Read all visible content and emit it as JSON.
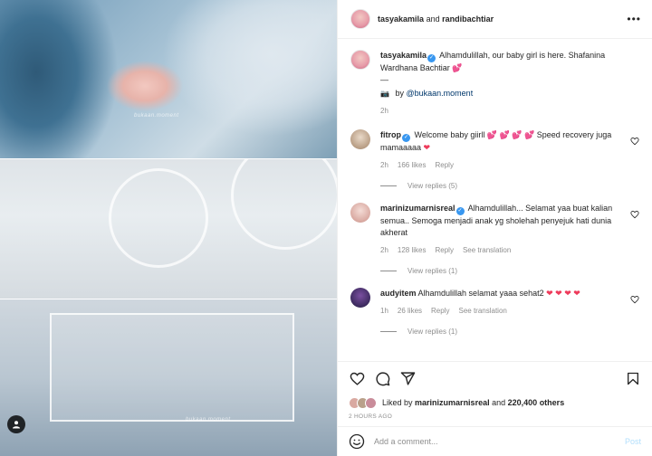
{
  "post": {
    "header": {
      "username": "tasyakamila",
      "and_text": "and",
      "collaborator": "randibachtiar",
      "more_label": "•••"
    },
    "caption": {
      "username": "tasyakamila",
      "text": "Alhamdulillah, our baby girl is here. Shafanina Wardhana Bachtiar",
      "emoji": "💕",
      "separator": "—",
      "credit_prefix": "by",
      "credit_handle": "@bukaan.moment",
      "time": "2h"
    },
    "comments": [
      {
        "username": "fitrop",
        "text": "Welcome baby giirll",
        "emoji": "💕 💕 💕 💕",
        "text2": "Speed recovery juga mamaaaaa",
        "emoji2": "❤",
        "time": "2h",
        "likes": "166 likes",
        "reply": "Reply",
        "translate": "",
        "view_replies": "View replies (5)"
      },
      {
        "username": "marinizumarnisreal",
        "text": "Alhamdulillah... Selamat yaa buat kalian semua.. Semoga menjadi anak yg sholehah penyejuk hati dunia akherat",
        "emoji": "",
        "text2": "",
        "emoji2": "",
        "time": "2h",
        "likes": "128 likes",
        "reply": "Reply",
        "translate": "See translation",
        "view_replies": "View replies (1)"
      },
      {
        "username": "audyitem",
        "text": "Alhamdulillah selamat yaaa sehat2",
        "emoji": "❤ ❤ ❤ ❤",
        "text2": "",
        "emoji2": "",
        "time": "1h",
        "likes": "26 likes",
        "reply": "Reply",
        "translate": "See translation",
        "view_replies": "View replies (1)"
      }
    ],
    "liked_by": {
      "prefix": "Liked by",
      "user": "marinizumarnisreal",
      "and": "and",
      "others": "220,400 others"
    },
    "time_ago": "2 HOURS AGO",
    "add_comment": {
      "placeholder": "Add a comment...",
      "post_label": "Post"
    },
    "media": {
      "watermark": "bukaan.moment"
    }
  },
  "colors": {
    "link": "#00376b",
    "verified": "#3897f0",
    "muted": "#8e8e8e",
    "post_disabled": "#b2dffc",
    "heart": "#ee3b5b"
  },
  "icons": [
    "more-icon",
    "heart-icon",
    "comment-icon",
    "share-icon",
    "save-icon",
    "emoji-icon",
    "tag-user-icon",
    "verified-icon"
  ]
}
